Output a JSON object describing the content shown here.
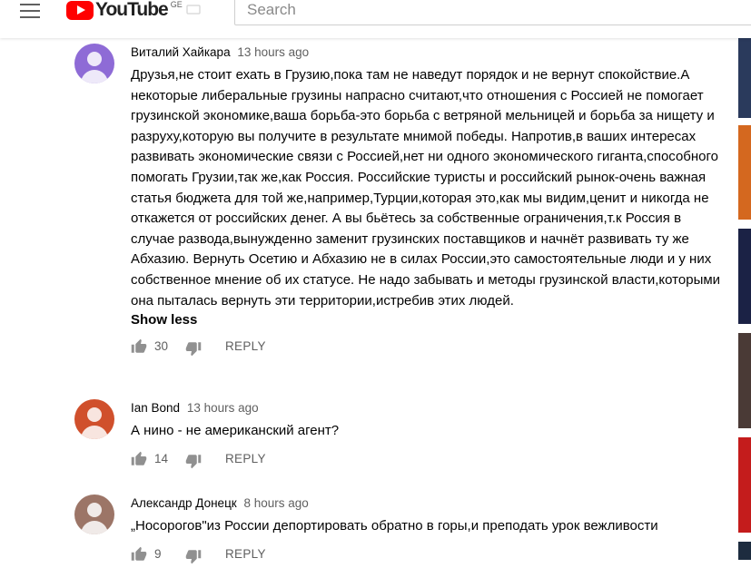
{
  "header": {
    "logo_text": "YouTube",
    "country_code": "GE",
    "search_placeholder": "Search"
  },
  "comments": [
    {
      "author": "Виталий Хайкара",
      "time": "13 hours ago",
      "avatar_color": "#8e6bd6",
      "text": "Друзья,не стоит ехать в Грузию,пока там не наведут порядок и не вернут спокойствие.А некоторые либеральные грузины напрасно считают,что отношения с Россией не помогает грузинской экономике,ваша борьба-это борьба с ветряной мельницей и борьба за нищету и разруху,которую вы получите в результате мнимой победы. Напротив,в ваших интересах развивать экономические связи с Россией,нет ни одного экономического гиганта,способного помогать Грузии,так же,как Россия. Российские туристы и российский рынок-очень важная статья бюджета для той же,например,Турции,которая это,как мы видим,ценит и никогда не откажется от российских денег. А вы бьётесь за собственные ограничения,т.к Россия в случае развода,вынужденно заменит грузинских поставщиков и начнёт развивать ту же Абхазию. Вернуть Осетию и Абхазию не в силах России,это самостоятельные люди и у них собственное мнение об их статусе. Не надо забывать и методы грузинской власти,которыми она пыталась вернуть эти территории,истребив этих людей.",
      "show_less": "Show less",
      "likes": "30",
      "reply": "REPLY"
    },
    {
      "author": "Ian Bond",
      "time": "13 hours ago",
      "avatar_color": "#d0502c",
      "text": "А нино - не американский агент?",
      "likes": "14",
      "reply": "REPLY"
    },
    {
      "author": "Александр Донецк",
      "time": "8 hours ago",
      "avatar_color": "#9c7567",
      "text": "„Носорогов\"из России депортировать обратно в горы,и преподать урок вежливости",
      "likes": "9",
      "reply": "REPLY"
    }
  ],
  "sidebar_thumbnails": [
    {
      "color": "#2a3a5c"
    },
    {
      "color": "#d4681f"
    },
    {
      "color": "#1b2245"
    },
    {
      "color": "#4a3a36"
    },
    {
      "color": "#c41c1c"
    },
    {
      "color": "#1d2c3f"
    }
  ]
}
